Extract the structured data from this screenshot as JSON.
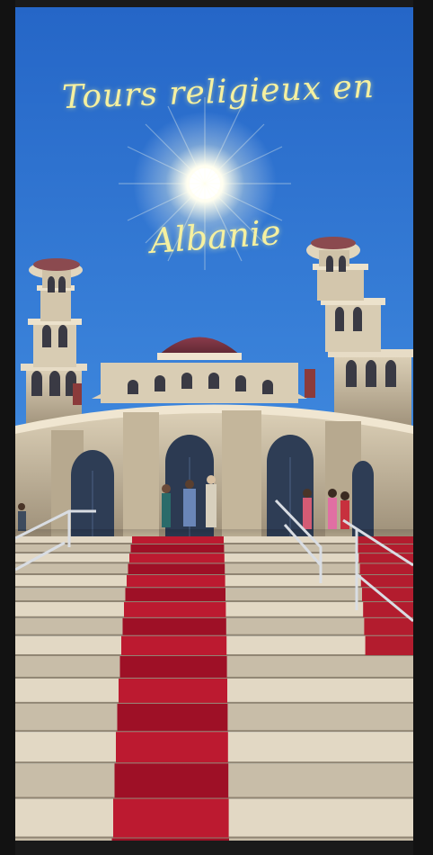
{
  "caption": {
    "line1": "Tours religieux en",
    "line2": "Albanie"
  },
  "colors": {
    "sky_top": "#2f73cf",
    "sky_bottom": "#6aa8e8",
    "caption": "#f5f0a0",
    "carpet": "#b0152a",
    "stone": "#c9bba1"
  }
}
